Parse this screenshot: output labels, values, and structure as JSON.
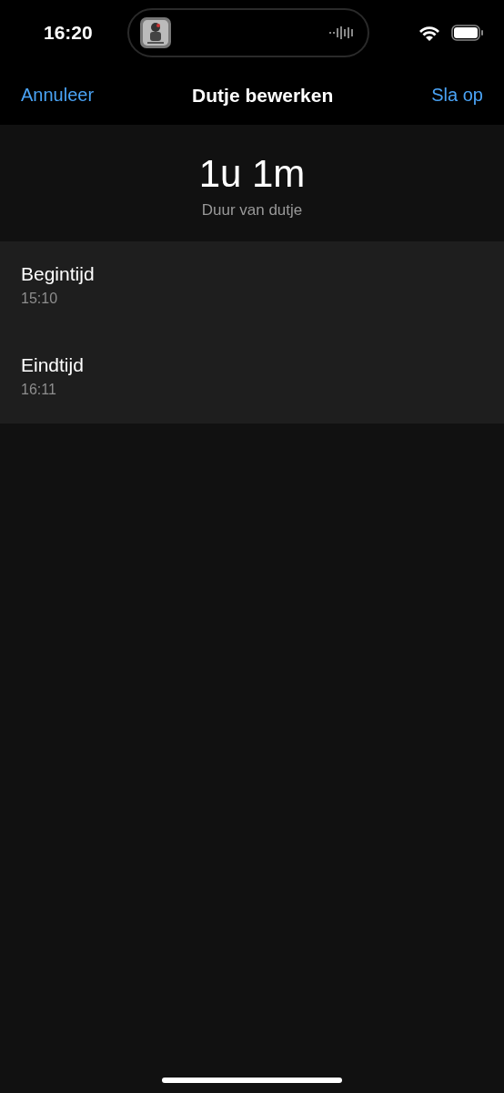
{
  "status_bar": {
    "time": "16:20"
  },
  "nav": {
    "cancel": "Annuleer",
    "title": "Dutje bewerken",
    "save": "Sla op"
  },
  "summary": {
    "duration": "1u 1m",
    "caption": "Duur van dutje"
  },
  "fields": [
    {
      "label": "Begintijd",
      "value": "15:10"
    },
    {
      "label": "Eindtijd",
      "value": "16:11"
    }
  ]
}
